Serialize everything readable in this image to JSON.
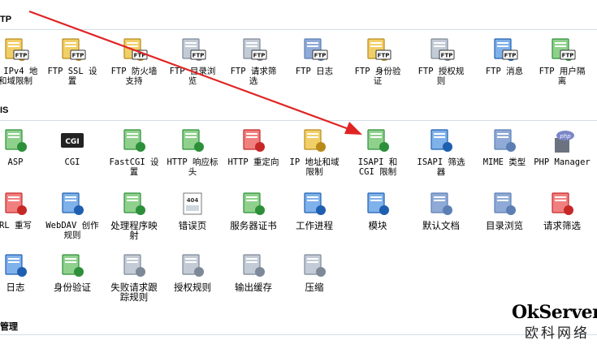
{
  "sections": {
    "ftp": "TP",
    "iis": "IS",
    "mgmt": "管理"
  },
  "ftp_items": [
    {
      "label": "P IPv4 地\n和域限制",
      "icon": "ftp-ipv4-icon"
    },
    {
      "label": "FTP SSL 设\n置",
      "icon": "ftp-ssl-icon"
    },
    {
      "label": "FTP 防火墙\n支持",
      "icon": "ftp-firewall-icon"
    },
    {
      "label": "FTP 目录浏\n览",
      "icon": "ftp-directory-icon"
    },
    {
      "label": "FTP 请求筛\n选",
      "icon": "ftp-request-filter-icon"
    },
    {
      "label": "FTP 日志",
      "icon": "ftp-log-icon"
    },
    {
      "label": "FTP 身份验\n证",
      "icon": "ftp-auth-icon"
    },
    {
      "label": "FTP 授权规\n则",
      "icon": "ftp-authz-icon"
    },
    {
      "label": "FTP 消息",
      "icon": "ftp-message-icon"
    },
    {
      "label": "FTP 用户隔\n离",
      "icon": "ftp-user-isolation-icon"
    }
  ],
  "iis_row1": [
    {
      "label": "ASP",
      "icon": "asp-icon"
    },
    {
      "label": "CGI",
      "icon": "cgi-icon"
    },
    {
      "label": "FastCGI 设\n置",
      "icon": "fastcgi-icon"
    },
    {
      "label": "HTTP 响应标\n头",
      "icon": "http-headers-icon"
    },
    {
      "label": "HTTP 重定向",
      "icon": "http-redirect-icon"
    },
    {
      "label": "IP 地址和域\n限制",
      "icon": "ip-restrictions-icon"
    },
    {
      "label": "ISAPI 和\nCGI 限制",
      "icon": "isapi-cgi-icon"
    },
    {
      "label": "ISAPI 筛选\n器",
      "icon": "isapi-filter-icon"
    },
    {
      "label": "MIME 类型",
      "icon": "mime-icon"
    },
    {
      "label": "PHP Manager",
      "icon": "php-icon"
    }
  ],
  "iis_row2": [
    {
      "label": "RL 重写",
      "icon": "url-rewrite-icon"
    },
    {
      "label": "WebDAV 创作\n规则",
      "icon": "webdav-icon"
    },
    {
      "label": "处理程序映\n射",
      "icon": "handler-icon"
    },
    {
      "label": "错误页",
      "icon": "error-page-icon"
    },
    {
      "label": "服务器证书",
      "icon": "certificate-icon"
    },
    {
      "label": "工作进程",
      "icon": "worker-process-icon"
    },
    {
      "label": "模块",
      "icon": "modules-icon"
    },
    {
      "label": "默认文档",
      "icon": "default-doc-icon"
    },
    {
      "label": "目录浏览",
      "icon": "dir-browse-icon"
    },
    {
      "label": "请求筛选",
      "icon": "request-filter-icon"
    }
  ],
  "iis_row3": [
    {
      "label": "日志",
      "icon": "logging-icon"
    },
    {
      "label": "身份验证",
      "icon": "authentication-icon"
    },
    {
      "label": "失败请求跟\n踪规则",
      "icon": "failed-request-icon"
    },
    {
      "label": "授权规则",
      "icon": "authorization-icon"
    },
    {
      "label": "输出缓存",
      "icon": "output-cache-icon"
    },
    {
      "label": "压缩",
      "icon": "compression-icon"
    }
  ],
  "watermark": {
    "brand": "OkServer",
    "sub": "欧科网络"
  },
  "colors": {
    "arrow": "#e02424",
    "badge_text": "FTP"
  }
}
